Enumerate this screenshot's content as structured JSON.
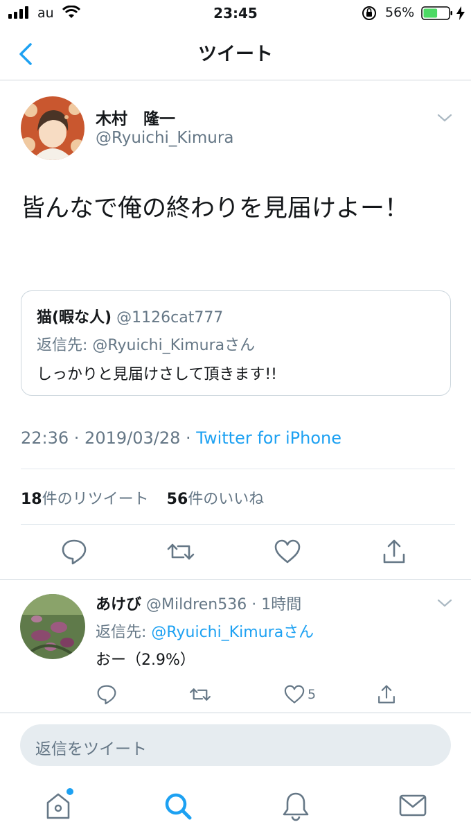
{
  "status_bar": {
    "carrier": "au",
    "time": "23:45",
    "battery": "56%",
    "battery_level": 0.56
  },
  "nav": {
    "title": "ツイート",
    "back_icon": "chevron-left-icon"
  },
  "tweet": {
    "display_name": "木村　隆一",
    "handle": "@Ryuichi_Kimura",
    "text": "皆んなで俺の終わりを見届けよー！",
    "quote": {
      "display_name": "猫(暇な人)",
      "handle": "@1126cat777",
      "reply_to_label": "返信先: @Ryuichi_Kimuraさん",
      "text": "しっかりと見届けさして頂きます!!"
    },
    "timestamp": "22:36 · 2019/03/28 ·",
    "source": "Twitter for iPhone",
    "retweet_count": "18",
    "retweet_label": "件のリツイート",
    "like_count": "56",
    "like_label": "件のいいね"
  },
  "reply": {
    "display_name": "あけび",
    "handle": "@Mildren536",
    "time": "· 1時間",
    "reply_to_prefix": "返信先:",
    "reply_to_handle": "@Ryuichi_Kimuraさん",
    "text": "おー（2.9%）",
    "like_count": "5"
  },
  "compose": {
    "placeholder": "返信をツイート"
  },
  "tabs": [
    "home-icon",
    "search-icon",
    "notifications-icon",
    "messages-icon"
  ],
  "colors": {
    "accent": "#1da1f2",
    "muted": "#657786",
    "battery": "#4cd964"
  }
}
